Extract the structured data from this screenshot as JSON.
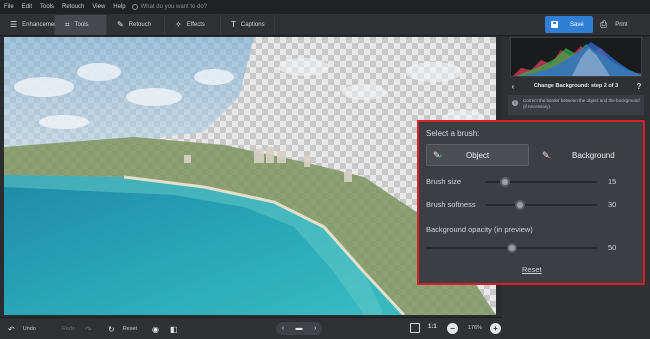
{
  "menu": {
    "items": [
      "File",
      "Edit",
      "Tools",
      "Retouch",
      "View",
      "Help"
    ],
    "search_placeholder": "What do you want to do?"
  },
  "toolbar": {
    "tabs": [
      {
        "label": "Enhancement",
        "icon": "sliders-icon"
      },
      {
        "label": "Tools",
        "icon": "crop-icon"
      },
      {
        "label": "Retouch",
        "icon": "brush-icon"
      },
      {
        "label": "Effects",
        "icon": "magic-wand-icon"
      },
      {
        "label": "Captions",
        "icon": "text-icon"
      }
    ],
    "active_tab": "Tools",
    "save_label": "Save",
    "print_label": "Print",
    "accent_color": "#2f7fd6"
  },
  "right_panel": {
    "step_title": "Change Background: step 2 of 3",
    "info_text": "Correct the border between the object and the background (if necessary)."
  },
  "brush_panel": {
    "title": "Select a brush:",
    "object_label": "Object",
    "background_label": "Background",
    "brush_size_label": "Brush size",
    "brush_size_value": "15",
    "brush_softness_label": "Brush softness",
    "brush_softness_value": "30",
    "bg_opacity_label": "Background opacity (in preview)",
    "bg_opacity_value": "50",
    "reset_label": "Reset",
    "highlight_color": "#d61f26"
  },
  "bottom_bar": {
    "undo_label": "Undo",
    "redo_label": "Redo",
    "reset_label": "Reset",
    "one_to_one": "1:1",
    "zoom": "176%"
  }
}
